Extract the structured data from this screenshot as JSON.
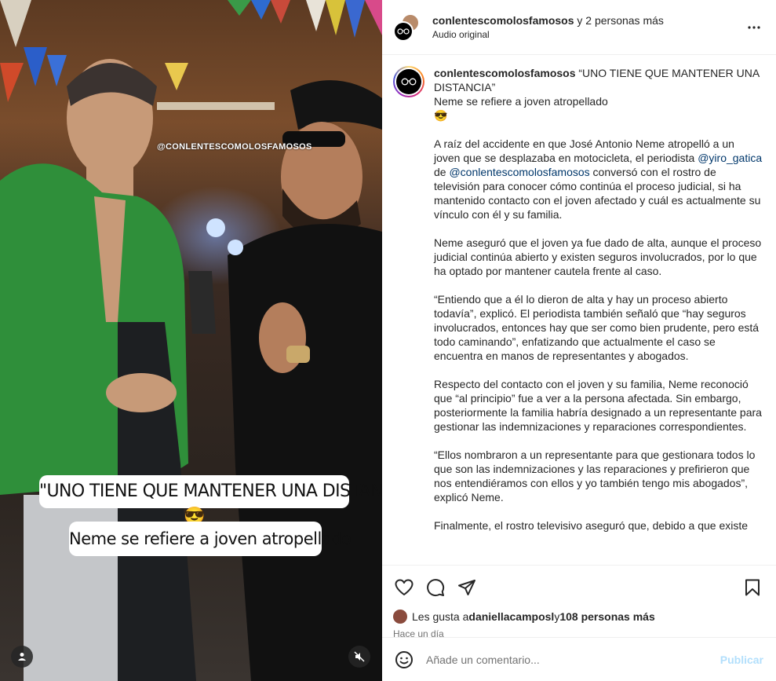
{
  "header": {
    "username": "conlentescomolosfamosos",
    "others": " y 2 personas más",
    "audio": "Audio original"
  },
  "post": {
    "username": "conlentescomolosfamosos",
    "title": "“UNO TIENE QUE MANTENER UNA DISTANCIA”",
    "subtitle": "Neme se refiere a joven atropellado",
    "emoji": "😎",
    "p1_a": "A raíz del accidente en que José Antonio Neme atropelló a un joven que se desplazaba en motocicleta, el periodista ",
    "p1_mention1": "@yiro_gatica",
    "p1_b": " de ",
    "p1_mention2": "@conlentescomolosfamosos",
    "p1_c": " conversó con el rostro de televisión para conocer cómo continúa el proceso judicial, si ha mantenido contacto con el joven afectado y cuál es actualmente su vínculo con él y su familia.",
    "p2": "Neme aseguró que el joven ya fue dado de alta, aunque el proceso judicial continúa abierto y existen seguros involucrados, por lo que ha optado por mantener cautela frente al caso.",
    "p3": "“Entiendo que a él lo dieron de alta y hay un proceso abierto todavía”, explicó. El periodista también señaló que “hay seguros involucrados, entonces hay que ser como bien prudente, pero está todo caminando”, enfatizando que actualmente el caso se encuentra en manos de representantes y abogados.",
    "p4": "Respecto del contacto con el joven y su familia, Neme reconoció que “al principio” fue a ver a la persona afectada. Sin embargo, posteriormente la familia habría designado a un representante para gestionar las indemnizaciones y reparaciones correspondientes.",
    "p5": "“Ellos nombraron a un representante para que gestionara todos lo que son las indemnizaciones y las reparaciones y prefirieron que nos entendiéramos con ellos y yo también tengo mis abogados”, explicó Neme.",
    "p6": "Finalmente, el rostro televisivo aseguró que, debido a que existe"
  },
  "video": {
    "caption_line1": "\"UNO TIENE QUE MANTENER UNA DISTANCIA\"",
    "caption_emoji": "😎",
    "caption_line2": "Neme se refiere a joven atropellado",
    "watermark": "@CONLENTESCOMOLOSFAMOSOS"
  },
  "likes": {
    "prefix": "Les gusta a ",
    "user": "daniellacamposl",
    "suffix": " y ",
    "count": "108 personas más"
  },
  "time_ago": "Hace un día",
  "comment": {
    "placeholder": "Añade un comentario...",
    "post_label": "Publicar"
  },
  "icons": {
    "like": "heart-icon",
    "comment": "comment-icon",
    "share": "share-icon",
    "save": "bookmark-icon",
    "emoji": "emoji-icon",
    "more": "more-icon",
    "mute": "muted-icon",
    "tags": "user-tag-icon"
  },
  "colors": {
    "link": "#00376b",
    "post_button": "#b2dffc",
    "muted_text": "#737373"
  }
}
